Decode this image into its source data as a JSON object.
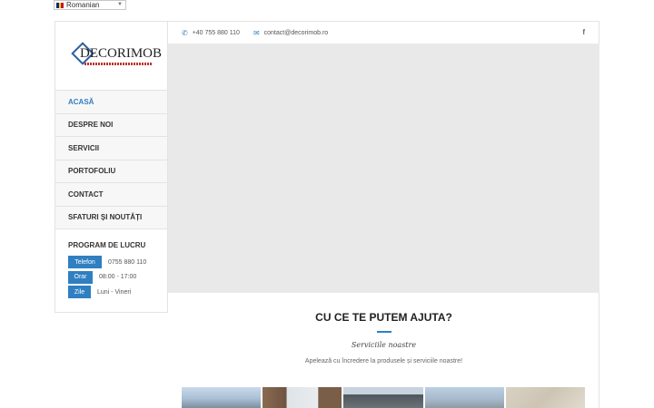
{
  "language_selector": {
    "label": "Romanian",
    "flag_colors": [
      "#002b7f",
      "#fcd116",
      "#ce1126"
    ]
  },
  "logo": {
    "text": "DECORIMOB"
  },
  "nav": {
    "items": [
      {
        "label": "ACASĂ",
        "active": true
      },
      {
        "label": "DESPRE NOI",
        "active": false
      },
      {
        "label": "SERVICII",
        "active": false
      },
      {
        "label": "PORTOFOLIU",
        "active": false
      },
      {
        "label": "CONTACT",
        "active": false
      },
      {
        "label": "SFATURI ȘI NOUTĂȚI",
        "active": false
      }
    ]
  },
  "hours": {
    "title": "PROGRAM DE LUCRU",
    "rows": [
      {
        "label": "Telefon",
        "value": "0755 880 110"
      },
      {
        "label": "Orar",
        "value": "08:00 - 17:00"
      },
      {
        "label": "Zile",
        "value": "Luni - Vineri"
      }
    ]
  },
  "topbar": {
    "phone": "+40 755 880 110",
    "email": "contact@decorimob.ro",
    "social_icon": "facebook-icon"
  },
  "section": {
    "title": "CU CE TE PUTEM AJUTA?",
    "subtitle": "Serviciile noastre",
    "description": "Apelează cu încredere la produsele și serviciile noastre!"
  },
  "colors": {
    "accent": "#2f7fc1",
    "slider_bg": "#e9e9e9",
    "border": "#e3e3e3"
  }
}
